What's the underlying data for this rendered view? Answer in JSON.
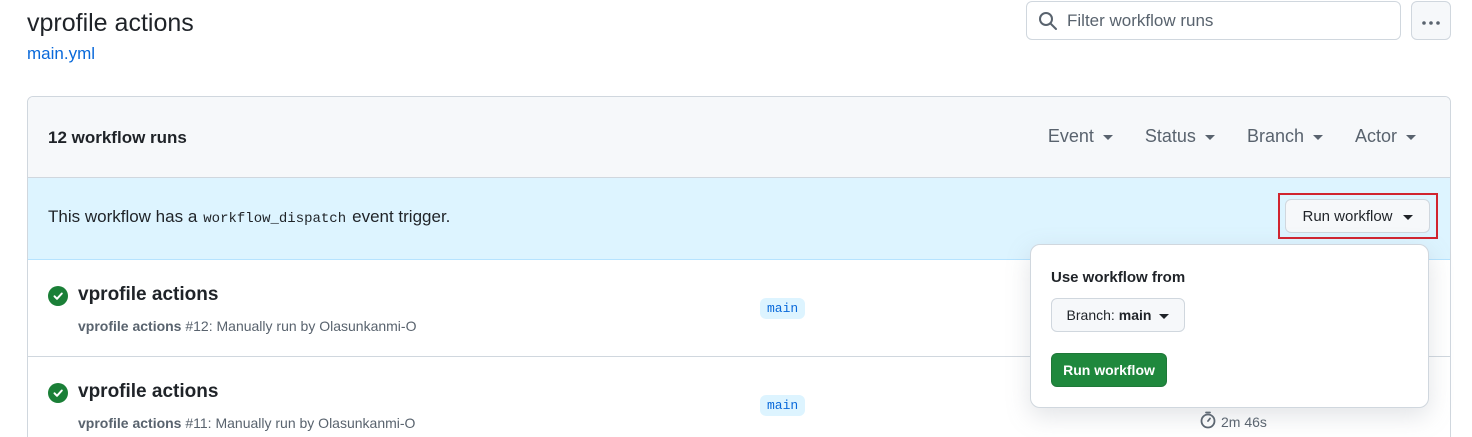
{
  "header": {
    "title": "vprofile actions",
    "subtitle": "main.yml"
  },
  "search": {
    "placeholder": "Filter workflow runs"
  },
  "panel": {
    "runs_count": "12 workflow runs",
    "filters": [
      "Event",
      "Status",
      "Branch",
      "Actor"
    ]
  },
  "banner": {
    "text_before": "This workflow has a",
    "code": "workflow_dispatch",
    "text_after": "event trigger.",
    "run_button": "Run workflow"
  },
  "runs": [
    {
      "title": "vprofile actions",
      "workflow": "vprofile actions",
      "detail": "#12: Manually run by Olasunkanmi-O",
      "branch": "main",
      "status": "success",
      "duration": ""
    },
    {
      "title": "vprofile actions",
      "workflow": "vprofile actions",
      "detail": "#11: Manually run by Olasunkanmi-O",
      "branch": "main",
      "status": "success",
      "duration": "2m 46s"
    }
  ],
  "dropdown": {
    "title": "Use workflow from",
    "branch_label": "Branch:",
    "branch_value": "main",
    "run_button": "Run workflow"
  },
  "colors": {
    "accent": "#0969da",
    "success": "#1a7f37",
    "primary_button": "#1f883d",
    "highlight": "#d1242f",
    "banner_bg": "#ddf4ff"
  }
}
